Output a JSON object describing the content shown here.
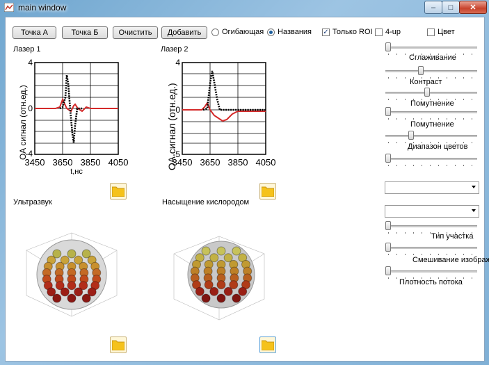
{
  "window": {
    "title": "main window",
    "min": "–",
    "max": "□",
    "close": "✕"
  },
  "toolbar": {
    "point_a": "Точка А",
    "point_b": "Точка Б",
    "clear": "Очистить",
    "add": "Добавить",
    "envelope": {
      "label": "Огибающая",
      "selected": false
    },
    "names": {
      "label": "Названия",
      "selected": true
    },
    "only_roi": {
      "label": "Только ROI",
      "checked": true
    },
    "four_up": {
      "label": "4-up",
      "checked": false
    },
    "color": {
      "label": "Цвет",
      "checked": false
    }
  },
  "laser1": {
    "label": "Лазер 1",
    "ylabel": "ОА сигнал (отн.ед.)",
    "xlabel": "t,нс",
    "y_ticks": [
      "4",
      "0",
      "-4"
    ],
    "x_ticks": [
      "3450",
      "3650",
      "3850",
      "4050"
    ]
  },
  "laser2": {
    "label": "Лазер 2",
    "ylabel": "ОА сигнал (отн.ед.)",
    "y_ticks": [
      "4",
      "0",
      "-5"
    ],
    "x_ticks": [
      "3450",
      "3650",
      "3850",
      "4050"
    ]
  },
  "ultrasound": {
    "label": "Ультразвук"
  },
  "oxygen": {
    "label": "Насыщение кислородом"
  },
  "sliders": [
    {
      "label": "Сглаживание",
      "value": 0.0
    },
    {
      "label": "Контраст",
      "value": 0.38
    },
    {
      "label": "Помутнение",
      "value": 0.45
    },
    {
      "label": "Помутнение",
      "value": 0.0
    },
    {
      "label": "Диапазон цветов",
      "value": 0.27
    },
    {
      "label": "",
      "value": 0.0
    }
  ],
  "combos": [
    {
      "value": ""
    },
    {
      "value": ""
    }
  ],
  "sliders2": [
    {
      "label": "Тип участка",
      "value": 0.0
    },
    {
      "label": "Смешивание изображение",
      "value": 0.0
    },
    {
      "label": "Плотность потока",
      "value": 0.0
    }
  ],
  "colors": {
    "red_trace": "#d42a2a",
    "black_trace": "#000000"
  }
}
